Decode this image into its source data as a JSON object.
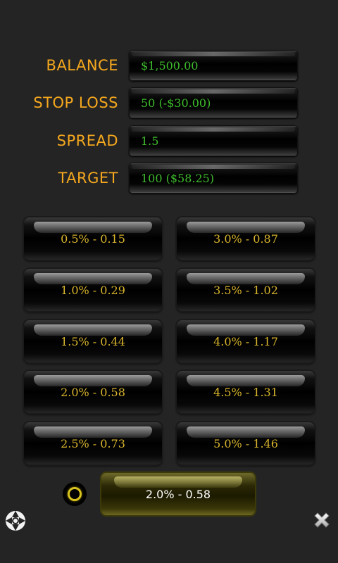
{
  "fields": [
    {
      "id": "balance",
      "label": "BALANCE",
      "value": "$1,500.00"
    },
    {
      "id": "stop-loss",
      "label": "STOP LOSS",
      "value": "50 (-$30.00)"
    },
    {
      "id": "spread",
      "label": "SPREAD",
      "value": "1.5"
    },
    {
      "id": "target",
      "label": "TARGET",
      "value": "100 ($58.25)"
    }
  ],
  "risk_buttons": [
    {
      "label": "0.5% - 0.15"
    },
    {
      "label": "3.0% - 0.87"
    },
    {
      "label": "1.0% - 0.29"
    },
    {
      "label": "3.5% - 1.02"
    },
    {
      "label": "1.5% - 0.44"
    },
    {
      "label": "4.0% - 1.17"
    },
    {
      "label": "2.0% - 0.58"
    },
    {
      "label": "4.5% - 1.31"
    },
    {
      "label": "2.5% - 0.73"
    },
    {
      "label": "5.0% - 1.46"
    }
  ],
  "result": {
    "label": "2.0% - 0.58"
  },
  "icons": {
    "camera": "camera-shutter-icon",
    "close": "close-icon",
    "ring": "radio-indicator-icon"
  },
  "colors": {
    "label": "#f5a81e",
    "value": "#3fbd2d",
    "button_text": "#d9b52d",
    "result_bg": "#2b2906"
  }
}
